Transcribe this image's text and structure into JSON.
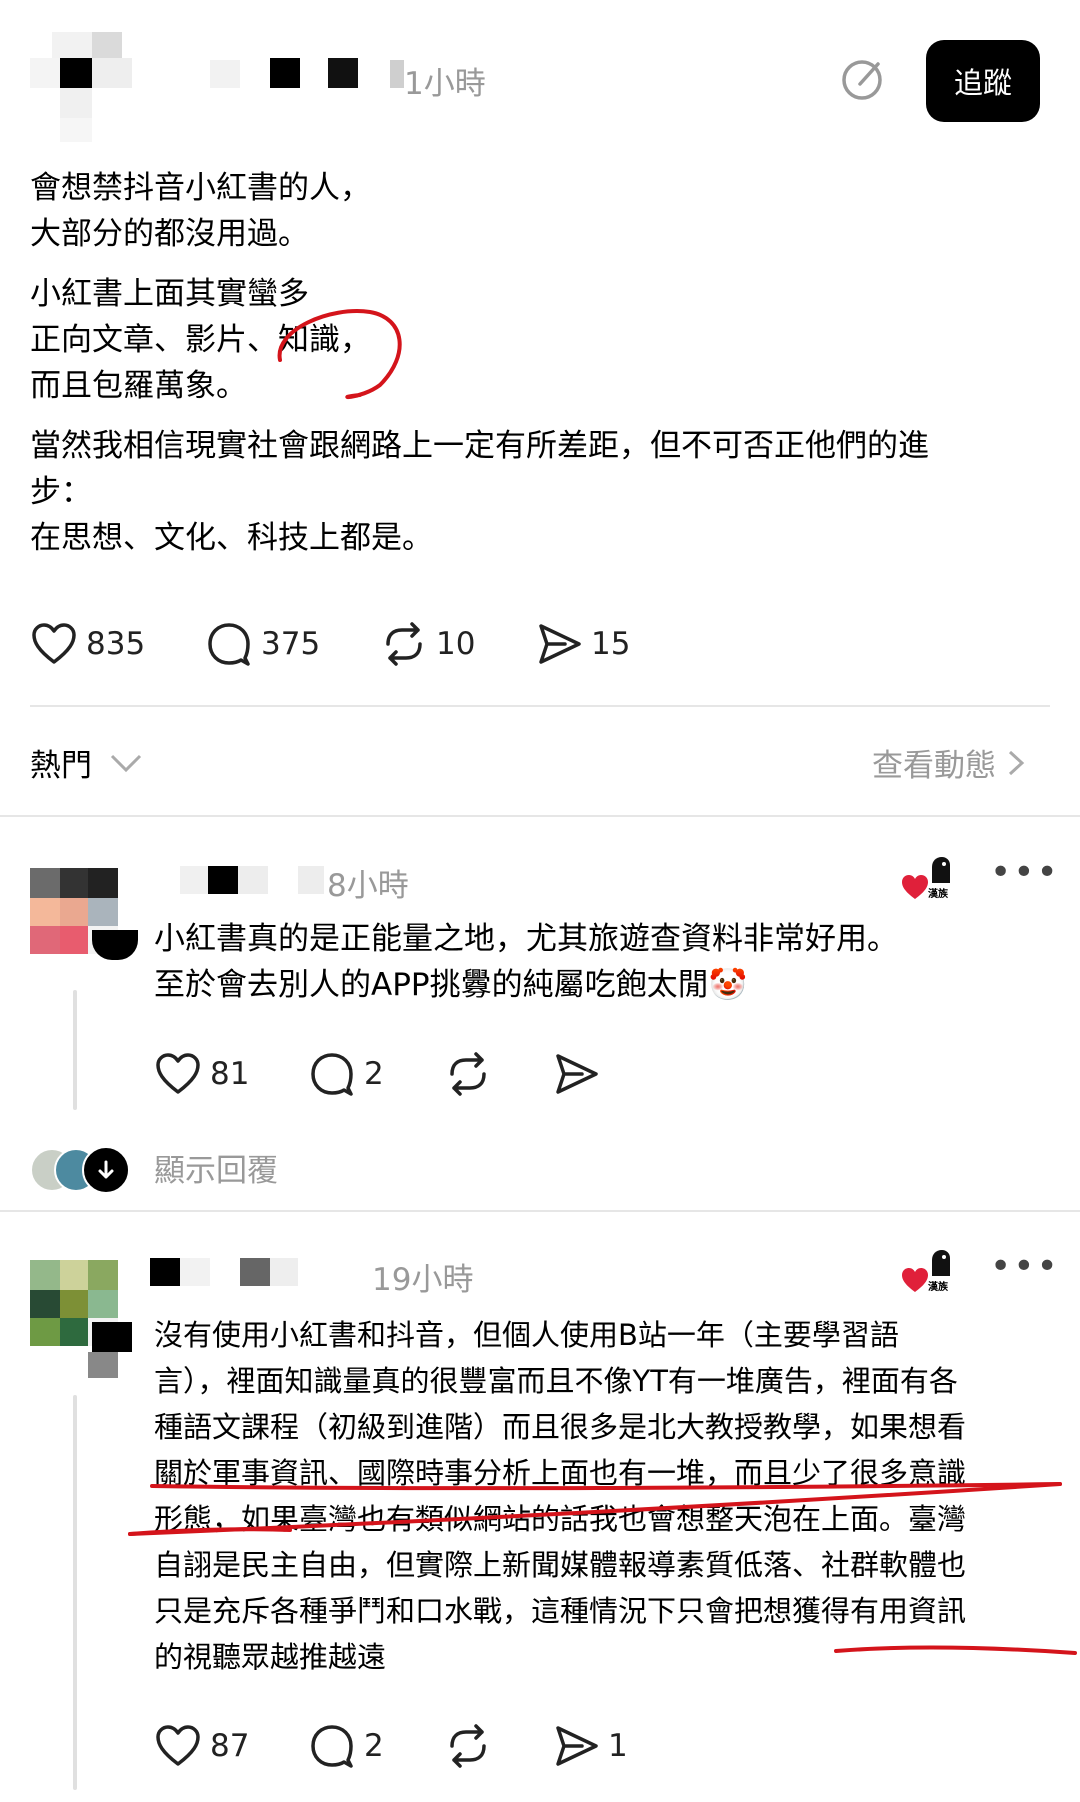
{
  "main_post": {
    "time": "1小時",
    "follow_label": "追蹤",
    "paragraphs": [
      [
        "會想禁抖音小紅書的人，",
        "大部分的都沒用過。"
      ],
      [
        "小紅書上面其實蠻多",
        "正向文章、影片、知識，",
        "而且包羅萬象。"
      ],
      [
        "當然我相信現實社會跟網路上一定有所差距，但不可否正他們的進",
        "步：",
        "在思想、文化、科技上都是。"
      ]
    ],
    "likes": "835",
    "comments": "375",
    "reposts": "10",
    "shares": "15"
  },
  "sort_bar": {
    "sort_label": "熱門",
    "activity_label": "查看動態"
  },
  "reply1": {
    "time": "8小時",
    "lines": [
      "小紅書真的是正能量之地，尤其旅遊查資料非常好用。",
      "至於會去別人的APP挑釁的純屬吃飽太閒🤡"
    ],
    "likes": "81",
    "comments": "2",
    "show_replies": "顯示回覆",
    "badge_text": "漢族"
  },
  "reply2": {
    "time": "19小時",
    "lines": [
      "沒有使用小紅書和抖音，但個人使用B站一年（主要學習語",
      "言），裡面知識量真的很豐富而且不像YT有一堆廣告，裡面有各",
      "種語文課程（初級到進階）而且很多是北大教授教學，如果想看",
      "關於軍事資訊、國際時事分析上面也有一堆，而且少了很多意識",
      "形態，如果臺灣也有類似網站的話我也會想整天泡在上面。臺灣",
      "自詡是民主自由，但實際上新聞媒體報導素質低落、社群軟體也",
      "只是充斥各種爭鬥和口水戰，這種情況下只會把想獲得有用資訊",
      "的視聽眾越推越遠"
    ],
    "likes": "87",
    "comments": "2",
    "shares": "1",
    "badge_text": "漢族"
  },
  "colors": {
    "annotation_red": "#d4141b",
    "heart_red": "#e0203a",
    "muted_text": "#999999"
  }
}
